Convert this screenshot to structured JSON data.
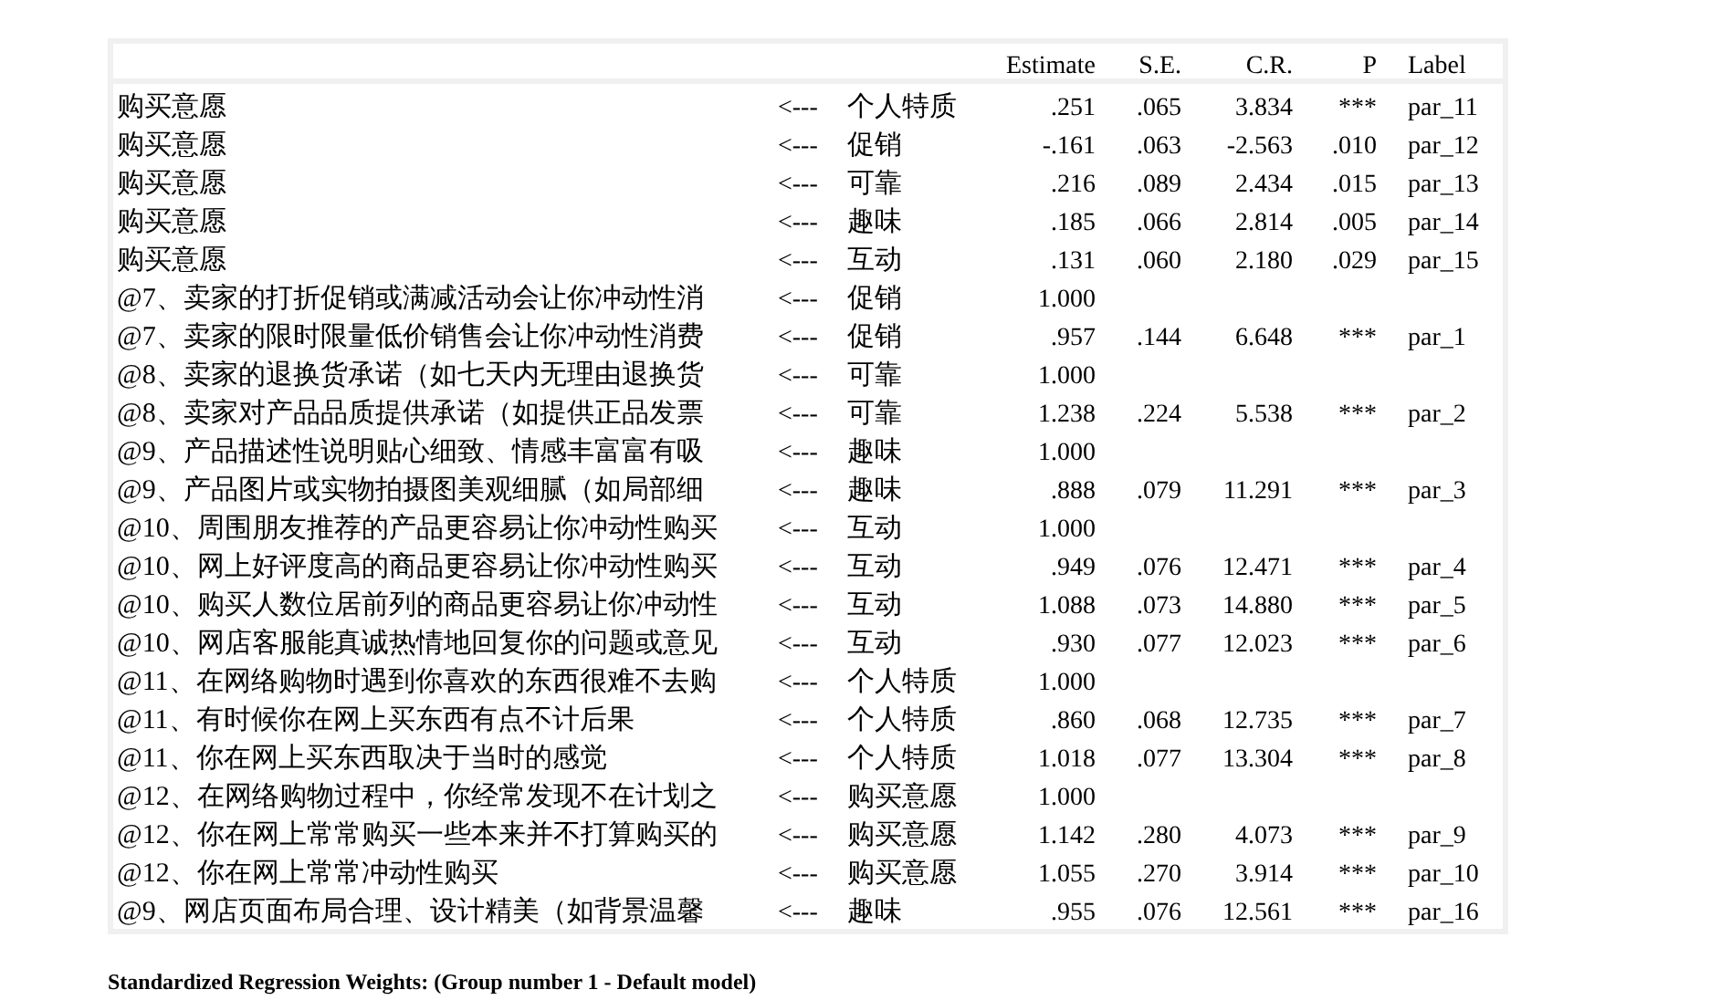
{
  "table": {
    "columns": [
      "Estimate",
      "S.E.",
      "C.R.",
      "P",
      "Label"
    ],
    "rows": [
      {
        "dependent": "购买意愿",
        "arrow": "<---",
        "predictor": "个人特质",
        "estimate": ".251",
        "se": ".065",
        "cr": "3.834",
        "p": "***",
        "label": "par_11"
      },
      {
        "dependent": "购买意愿",
        "arrow": "<---",
        "predictor": "促销",
        "estimate": "-.161",
        "se": ".063",
        "cr": "-2.563",
        "p": ".010",
        "label": "par_12"
      },
      {
        "dependent": "购买意愿",
        "arrow": "<---",
        "predictor": "可靠",
        "estimate": ".216",
        "se": ".089",
        "cr": "2.434",
        "p": ".015",
        "label": "par_13"
      },
      {
        "dependent": "购买意愿",
        "arrow": "<---",
        "predictor": "趣味",
        "estimate": ".185",
        "se": ".066",
        "cr": "2.814",
        "p": ".005",
        "label": "par_14"
      },
      {
        "dependent": "购买意愿",
        "arrow": "<---",
        "predictor": "互动",
        "estimate": ".131",
        "se": ".060",
        "cr": "2.180",
        "p": ".029",
        "label": "par_15"
      },
      {
        "dependent": "@7、卖家的打折促销或满减活动会让你冲动性消",
        "arrow": "<---",
        "predictor": "促销",
        "estimate": "1.000"
      },
      {
        "dependent": "@7、卖家的限时限量低价销售会让你冲动性消费",
        "arrow": "<---",
        "predictor": "促销",
        "estimate": ".957",
        "se": ".144",
        "cr": "6.648",
        "p": "***",
        "label": "par_1"
      },
      {
        "dependent": "@8、卖家的退换货承诺（如七天内无理由退换货",
        "arrow": "<---",
        "predictor": "可靠",
        "estimate": "1.000"
      },
      {
        "dependent": "@8、卖家对产品品质提供承诺（如提供正品发票",
        "arrow": "<---",
        "predictor": "可靠",
        "estimate": "1.238",
        "se": ".224",
        "cr": "5.538",
        "p": "***",
        "label": "par_2"
      },
      {
        "dependent": "@9、产品描述性说明贴心细致、情感丰富富有吸",
        "arrow": "<---",
        "predictor": "趣味",
        "estimate": "1.000"
      },
      {
        "dependent": "@9、产品图片或实物拍摄图美观细腻（如局部细",
        "arrow": "<---",
        "predictor": "趣味",
        "estimate": ".888",
        "se": ".079",
        "cr": "11.291",
        "p": "***",
        "label": "par_3"
      },
      {
        "dependent": "@10、周围朋友推荐的产品更容易让你冲动性购买",
        "arrow": "<---",
        "predictor": "互动",
        "estimate": "1.000"
      },
      {
        "dependent": "@10、网上好评度高的商品更容易让你冲动性购买",
        "arrow": "<---",
        "predictor": "互动",
        "estimate": ".949",
        "se": ".076",
        "cr": "12.471",
        "p": "***",
        "label": "par_4"
      },
      {
        "dependent": "@10、购买人数位居前列的商品更容易让你冲动性",
        "arrow": "<---",
        "predictor": "互动",
        "estimate": "1.088",
        "se": ".073",
        "cr": "14.880",
        "p": "***",
        "label": "par_5"
      },
      {
        "dependent": "@10、网店客服能真诚热情地回复你的问题或意见",
        "arrow": "<---",
        "predictor": "互动",
        "estimate": ".930",
        "se": ".077",
        "cr": "12.023",
        "p": "***",
        "label": "par_6"
      },
      {
        "dependent": "@11、在网络购物时遇到你喜欢的东西很难不去购",
        "arrow": "<---",
        "predictor": "个人特质",
        "estimate": "1.000"
      },
      {
        "dependent": "@11、有时候你在网上买东西有点不计后果",
        "arrow": "<---",
        "predictor": "个人特质",
        "estimate": ".860",
        "se": ".068",
        "cr": "12.735",
        "p": "***",
        "label": "par_7"
      },
      {
        "dependent": "@11、你在网上买东西取决于当时的感觉",
        "arrow": "<---",
        "predictor": "个人特质",
        "estimate": "1.018",
        "se": ".077",
        "cr": "13.304",
        "p": "***",
        "label": "par_8"
      },
      {
        "dependent": "@12、在网络购物过程中，你经常发现不在计划之",
        "arrow": "<---",
        "predictor": "购买意愿",
        "estimate": "1.000"
      },
      {
        "dependent": "@12、你在网上常常购买一些本来并不打算购买的",
        "arrow": "<---",
        "predictor": "购买意愿",
        "estimate": "1.142",
        "se": ".280",
        "cr": "4.073",
        "p": "***",
        "label": "par_9"
      },
      {
        "dependent": "@12、你在网上常常冲动性购买",
        "arrow": "<---",
        "predictor": "购买意愿",
        "estimate": "1.055",
        "se": ".270",
        "cr": "3.914",
        "p": "***",
        "label": "par_10"
      },
      {
        "dependent": "@9、网店页面布局合理、设计精美（如背景温馨",
        "arrow": "<---",
        "predictor": "趣味",
        "estimate": ".955",
        "se": ".076",
        "cr": "12.561",
        "p": "***",
        "label": "par_16"
      }
    ]
  },
  "footer_title": "Standardized Regression Weights: (Group number 1 - Default model)"
}
